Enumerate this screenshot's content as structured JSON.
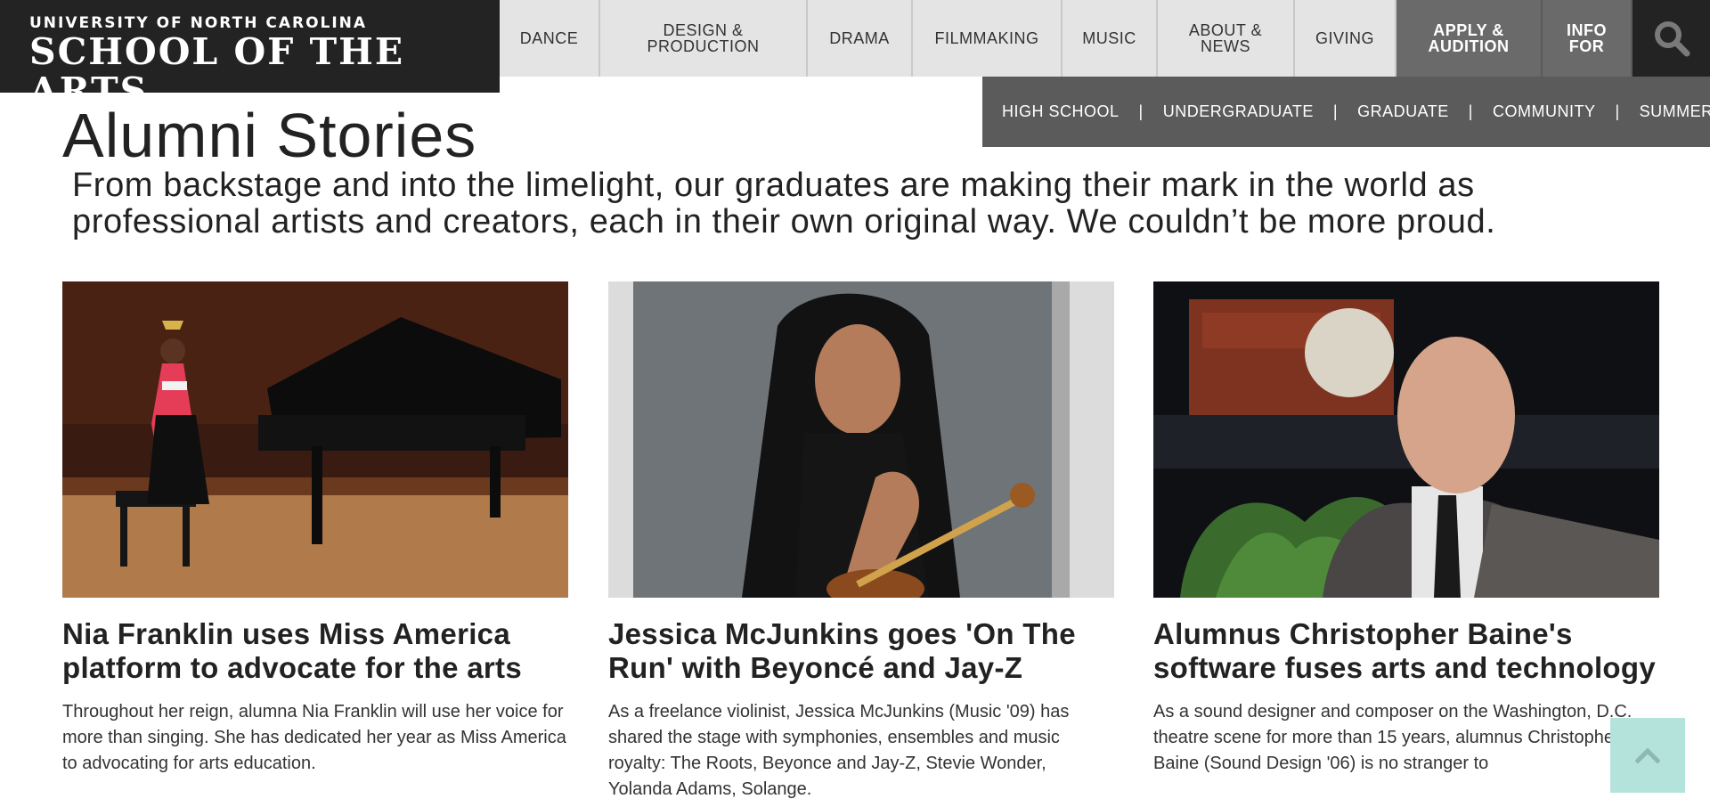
{
  "header": {
    "university": "UNIVERSITY OF NORTH CAROLINA",
    "school": "SCHOOL OF THE ARTS"
  },
  "nav": {
    "items": [
      {
        "label_lines": [
          "DANCE"
        ]
      },
      {
        "label_lines": [
          "DESIGN &",
          "PRODUCTION"
        ]
      },
      {
        "label_lines": [
          "DRAMA"
        ]
      },
      {
        "label_lines": [
          "FILMMAKING"
        ]
      },
      {
        "label_lines": [
          "MUSIC"
        ]
      },
      {
        "label_lines": [
          "ABOUT &",
          "NEWS"
        ]
      },
      {
        "label_lines": [
          "GIVING"
        ]
      },
      {
        "label_lines": [
          "APPLY &",
          "AUDITION"
        ]
      },
      {
        "label_lines": [
          "INFO",
          "FOR"
        ]
      }
    ],
    "search_icon": "search-icon"
  },
  "subnav": {
    "items": [
      "HIGH SCHOOL",
      "UNDERGRADUATE",
      "GRADUATE",
      "COMMUNITY",
      "SUMMER"
    ],
    "separator": "|"
  },
  "page": {
    "title": "Alumni Stories",
    "intro": "From backstage and into the limelight, our graduates are making their mark in the world as professional artists and creators, each in their own original way. We couldn’t be more proud."
  },
  "cards": [
    {
      "title": "Nia Franklin uses Miss America platform to advocate for the arts",
      "summary": "Throughout her reign, alumna Nia Franklin will use her voice for more than singing. She has dedicated her year as Miss America to advocating for arts education."
    },
    {
      "title": "Jessica McJunkins goes 'On The Run' with Beyoncé and Jay-Z",
      "summary": "As a freelance violinist, Jessica McJunkins (Music '09) has shared the stage with symphonies, ensembles and music royalty: The Roots, Beyonce and Jay-Z, Stevie Wonder, Yolanda Adams, Solange."
    },
    {
      "title": "Alumnus Christopher Baine's software fuses arts and technology",
      "summary": "As a sound designer and composer on the Washington, D.C. theatre scene for more than 15 years, alumnus Christopher Baine (Sound Design '06) is no stranger to"
    }
  ],
  "back_to_top_icon": "chevron-up-icon",
  "colors": {
    "header_dark": "#232323",
    "nav_bg": "#e4e4e4",
    "nav_highlight": "#6a6a6a",
    "subnav_bg": "#5b5b5b",
    "back_to_top_bg": "#b4e3dc"
  }
}
